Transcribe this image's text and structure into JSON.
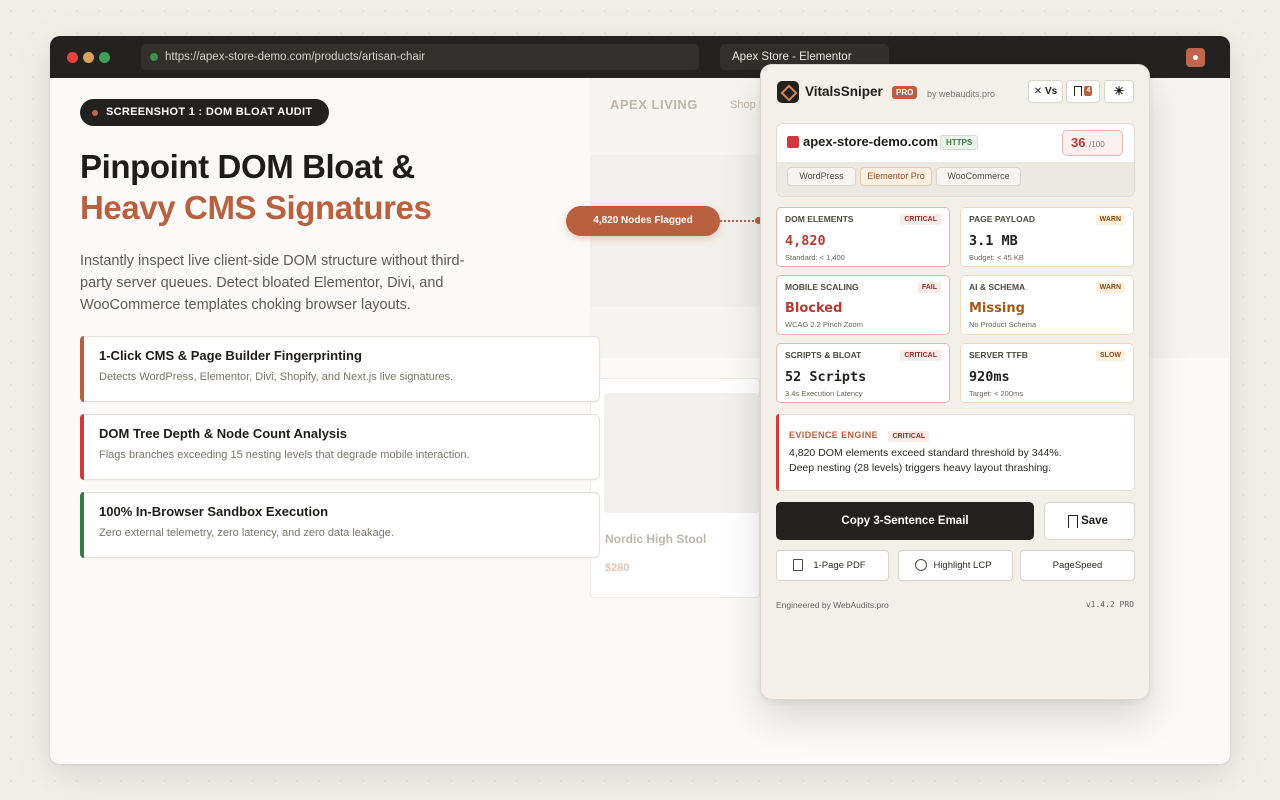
{
  "browser": {
    "url": "https://apex-store-demo.com/products/artisan-chair",
    "tab_title": "Apex Store - Elementor"
  },
  "hero": {
    "badge": "SCREENSHOT 1 : DOM BLOAT AUDIT",
    "title_line1": "Pinpoint DOM Bloat &",
    "title_line2": "Heavy CMS Signatures",
    "lead": "Instantly inspect live client-side DOM structure without third-party server queues. Detect bloated Elementor, Divi, and WooCommerce templates choking browser layouts."
  },
  "features": [
    {
      "title": "1-Click CMS & Page Builder Fingerprinting",
      "desc": "Detects WordPress, Elementor, Divi, Shopify, and Next.js live signatures.",
      "color": "#b9603f"
    },
    {
      "title": "DOM Tree Depth & Node Count Analysis",
      "desc": "Flags branches exceeding 15 nesting levels that degrade mobile interaction.",
      "color": "#d0393f"
    },
    {
      "title": "100% In-Browser Sandbox Execution",
      "desc": "Zero external telemetry, zero latency, and zero data leakage.",
      "color": "#3b7a48"
    }
  ],
  "site": {
    "brand": "APEX LIVING",
    "nav_partial": "Shop I",
    "product_name": "Nordic High Stool",
    "product_price": "$280"
  },
  "callout": "4,820 Nodes Flagged",
  "panel": {
    "name": "VitalsSniper",
    "pro": "PRO",
    "by": "by webaudits.pro",
    "vs_label": "Vs",
    "bookmark_count": "4",
    "domain": "apex-store-demo.com",
    "https": "HTTPS",
    "score": "36",
    "score_max": "/100",
    "chips": [
      "WordPress",
      "Elementor Pro",
      "WooCommerce"
    ],
    "metrics": [
      {
        "label": "DOM ELEMENTS",
        "tag": "CRITICAL",
        "value": "4,820",
        "sub": "Standard: < 1,400"
      },
      {
        "label": "PAGE PAYLOAD",
        "tag": "WARN",
        "value": "3.1 MB",
        "sub": "Budget: < 45 KB"
      },
      {
        "label": "MOBILE SCALING",
        "tag": "FAIL",
        "value": "Blocked",
        "sub": "WCAG 2.2 Pinch Zoom"
      },
      {
        "label": "AI & SCHEMA",
        "tag": "WARN",
        "value": "Missing",
        "sub": "No Product Schema"
      },
      {
        "label": "SCRIPTS & BLOAT",
        "tag": "CRITICAL",
        "value": "52 Scripts",
        "sub": "3.4s Execution Latency"
      },
      {
        "label": "SERVER TTFB",
        "tag": "SLOW",
        "value": "920ms",
        "sub": "Target: < 200ms"
      }
    ],
    "evidence_title": "EVIDENCE ENGINE",
    "evidence_tag": "CRITICAL",
    "evidence_line1": "4,820 DOM elements exceed standard threshold by 344%.",
    "evidence_line2": "Deep nesting (28 levels) triggers heavy layout thrashing.",
    "copy_button": "Copy 3-Sentence Email",
    "save_button": "Save",
    "pdf_button": "1-Page PDF",
    "lcp_button": "Highlight LCP",
    "pagespeed_button": "PageSpeed",
    "footer_left": "Engineered by WebAudits.pro",
    "footer_right": "v1.4.2 PRO"
  },
  "colors": {
    "accent": "#b9603f",
    "critical": "#d0393f",
    "success": "#3b7a48",
    "dark": "#23211f"
  }
}
